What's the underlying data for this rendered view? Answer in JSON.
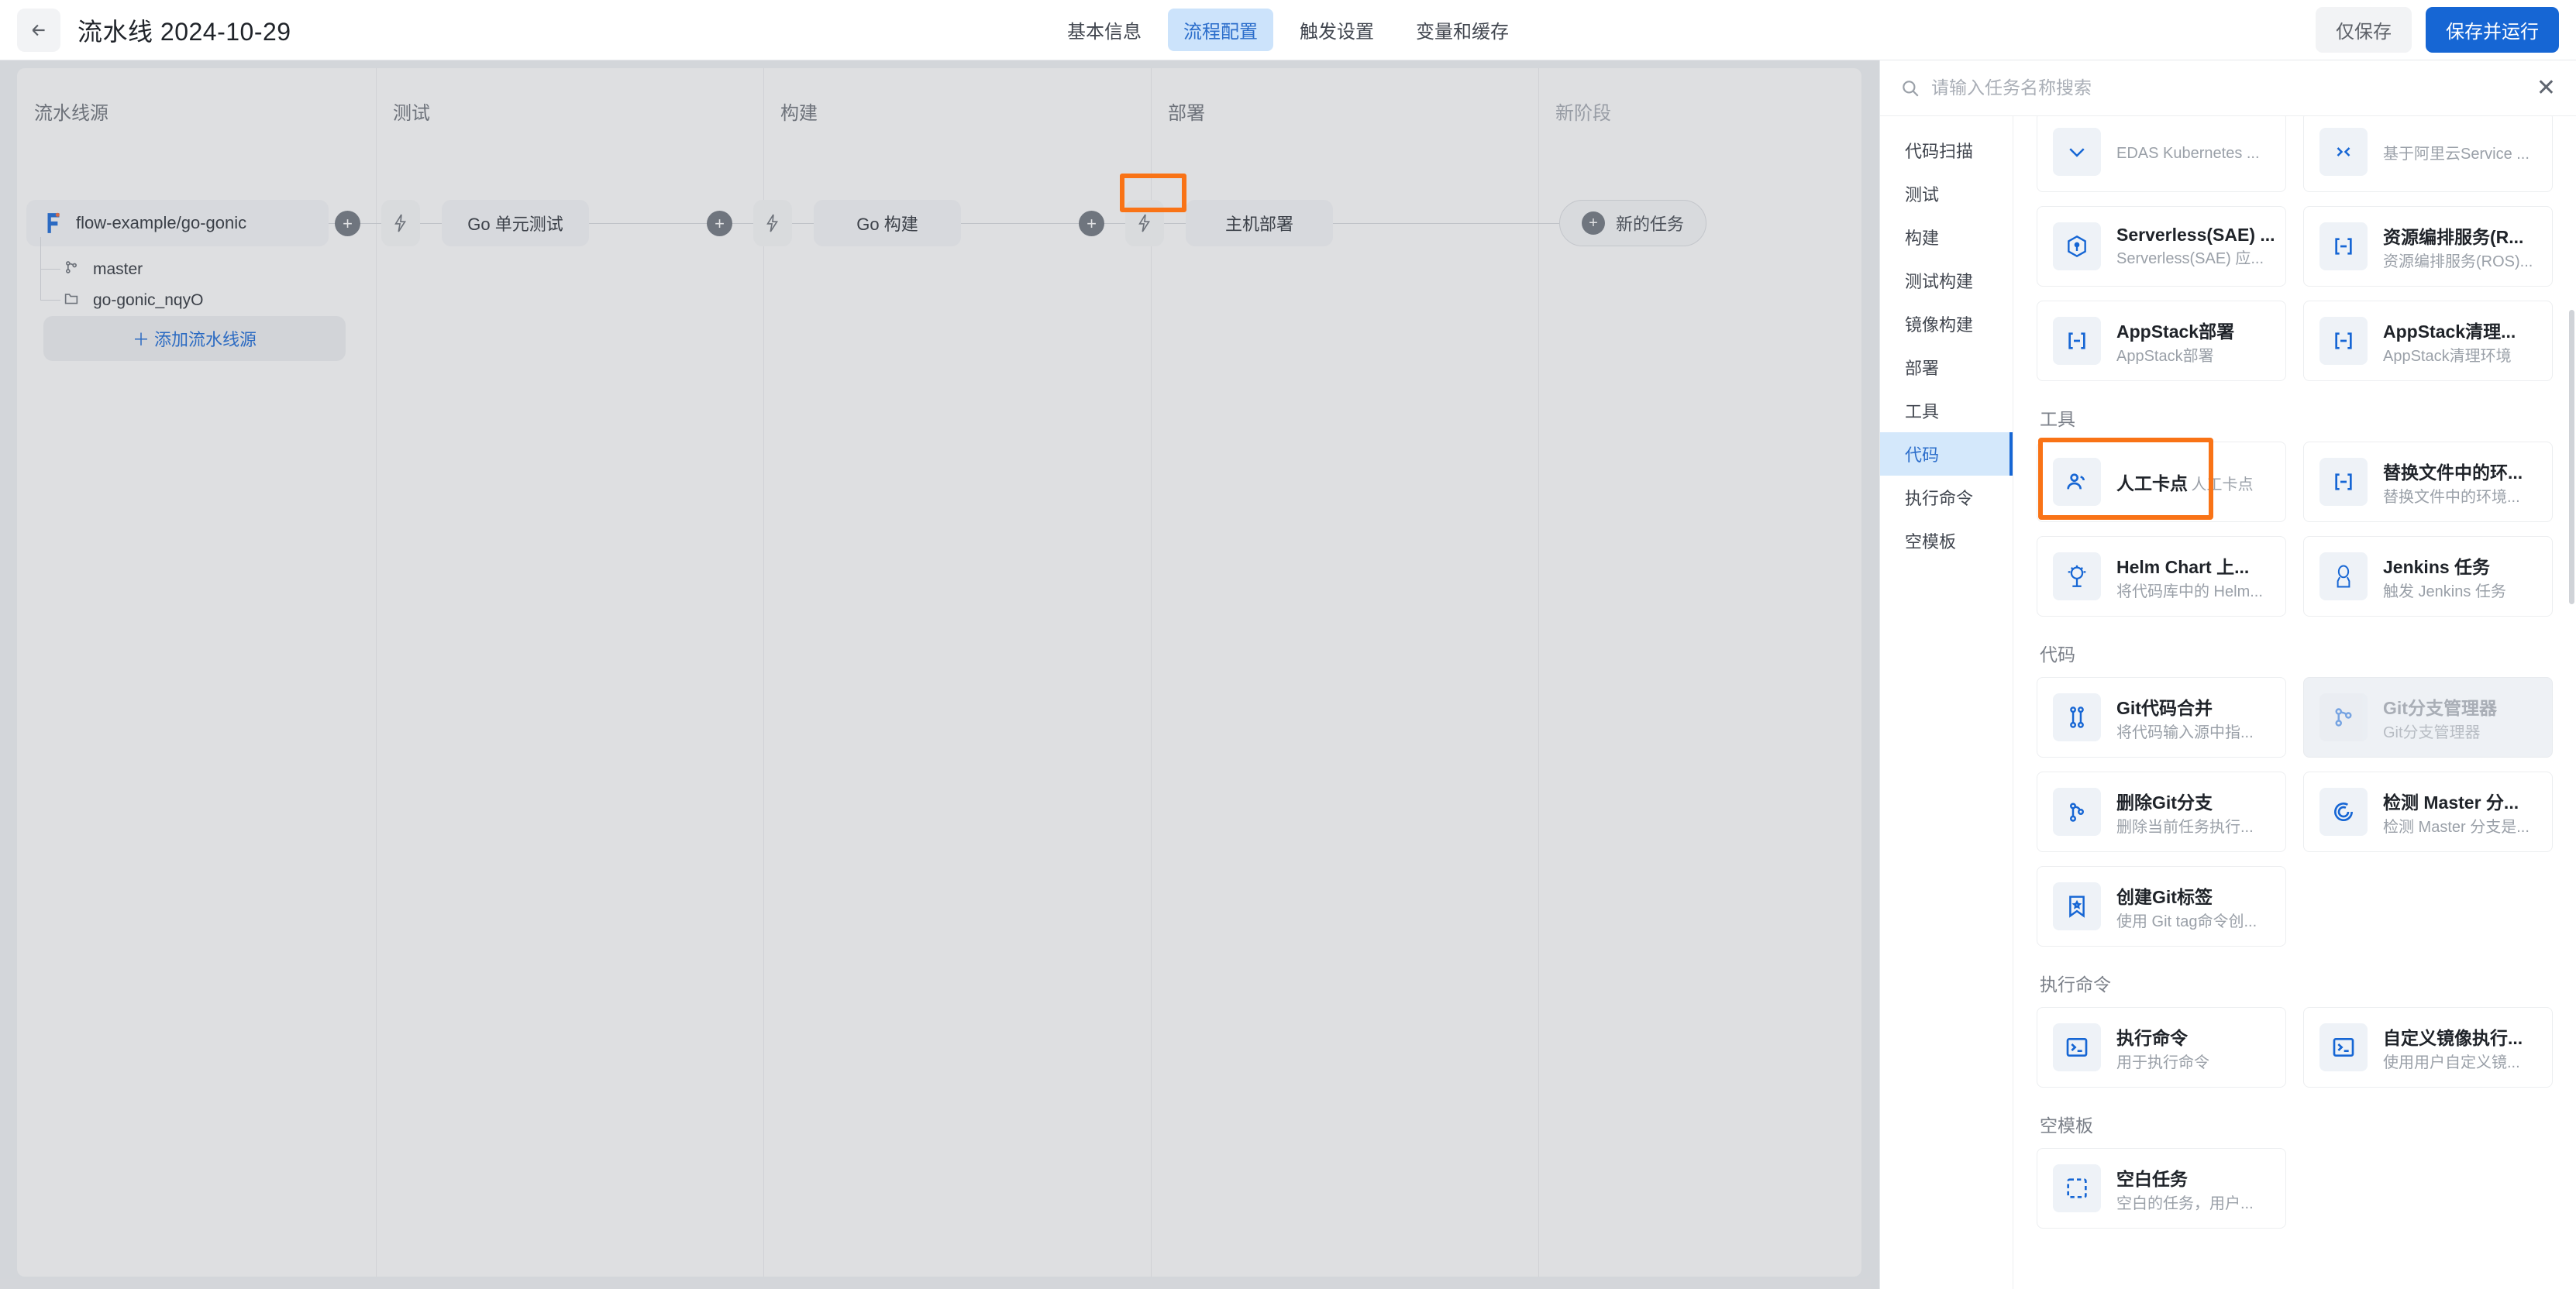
{
  "header": {
    "back_icon": "arrow-left-icon",
    "title": "流水线 2024-10-29",
    "tabs": [
      {
        "label": "基本信息",
        "active": false
      },
      {
        "label": "流程配置",
        "active": true
      },
      {
        "label": "触发设置",
        "active": false
      },
      {
        "label": "变量和缓存",
        "active": false
      }
    ],
    "save_only": "仅保存",
    "save_and_run": "保存并运行",
    "accent": "#1666d4"
  },
  "canvas": {
    "stages": [
      {
        "label": "流水线源",
        "muted": false
      },
      {
        "label": "测试",
        "muted": false
      },
      {
        "label": "构建",
        "muted": false
      },
      {
        "label": "部署",
        "muted": false
      },
      {
        "label": "新阶段",
        "muted": true
      }
    ],
    "source_node": {
      "label": "flow-example/go-gonic",
      "icon": "flow-logo-icon"
    },
    "source_tree": [
      {
        "label": "master",
        "icon": "git-branch-icon"
      },
      {
        "label": "go-gonic_nqyO",
        "icon": "folder-icon"
      }
    ],
    "add_source": "添加流水线源",
    "add_source_plus": "＋",
    "tasks": [
      {
        "label": "Go 单元测试"
      },
      {
        "label": "Go 构建"
      },
      {
        "label": "主机部署"
      }
    ],
    "new_task": "新的任务",
    "plus_glyph": "+",
    "bolt_glyph": "⚡",
    "highlight_color": "#f97316"
  },
  "panel": {
    "search": {
      "placeholder": "请输入任务名称搜索",
      "value": "",
      "icon": "search-icon",
      "close_icon": "close-icon",
      "close_glyph": "✕"
    },
    "categories": [
      {
        "label": "代码扫描",
        "active": false
      },
      {
        "label": "测试",
        "active": false
      },
      {
        "label": "构建",
        "active": false
      },
      {
        "label": "测试构建",
        "active": false
      },
      {
        "label": "镜像构建",
        "active": false
      },
      {
        "label": "部署",
        "active": false
      },
      {
        "label": "工具",
        "active": false
      },
      {
        "label": "代码",
        "active": true
      },
      {
        "label": "执行命令",
        "active": false
      },
      {
        "label": "空模板",
        "active": false
      }
    ],
    "groups": [
      {
        "title": "",
        "cards": [
          {
            "title": "",
            "desc": "EDAS Kubernetes ...",
            "icon": "edas-icon",
            "disabled": false,
            "clipped": true
          },
          {
            "title": "",
            "desc": "基于阿里云Service ...",
            "icon": "service-mesh-icon",
            "disabled": false,
            "clipped": true
          },
          {
            "title": "Serverless(SAE) ...",
            "desc": "Serverless(SAE) 应...",
            "icon": "sae-icon",
            "disabled": false
          },
          {
            "title": "资源编排服务(R...",
            "desc": "资源编排服务(ROS)...",
            "icon": "ros-icon",
            "disabled": false
          },
          {
            "title": "AppStack部署",
            "desc": "AppStack部署",
            "icon": "appstack-icon",
            "disabled": false
          },
          {
            "title": "AppStack清理...",
            "desc": "AppStack清理环境",
            "icon": "appstack-icon",
            "disabled": false
          }
        ]
      },
      {
        "title": "工具",
        "cards": [
          {
            "title": "人工卡点",
            "desc": "人工卡点",
            "icon": "users-icon",
            "disabled": false,
            "highlighted": true
          },
          {
            "title": "替换文件中的环...",
            "desc": "替换文件中的环境...",
            "icon": "appstack-icon",
            "disabled": false
          },
          {
            "title": "Helm Chart 上...",
            "desc": "将代码库中的 Helm...",
            "icon": "helm-icon",
            "disabled": false
          },
          {
            "title": "Jenkins 任务",
            "desc": "触发 Jenkins 任务",
            "icon": "jenkins-icon",
            "disabled": false
          }
        ]
      },
      {
        "title": "代码",
        "cards": [
          {
            "title": "Git代码合并",
            "desc": "将代码输入源中指...",
            "icon": "git-merge-icon",
            "disabled": false
          },
          {
            "title": "Git分支管理器",
            "desc": "Git分支管理器",
            "icon": "git-branch-icon",
            "disabled": true
          },
          {
            "title": "删除Git分支",
            "desc": "删除当前任务执行...",
            "icon": "git-branch-icon",
            "disabled": false
          },
          {
            "title": "检测 Master 分...",
            "desc": "检测 Master 分支是...",
            "icon": "target-icon",
            "disabled": false
          },
          {
            "title": "创建Git标签",
            "desc": "使用 Git tag命令创...",
            "icon": "tag-icon",
            "disabled": false
          }
        ]
      },
      {
        "title": "执行命令",
        "cards": [
          {
            "title": "执行命令",
            "desc": "用于执行命令",
            "icon": "terminal-icon",
            "disabled": false
          },
          {
            "title": "自定义镜像执行...",
            "desc": "使用用户自定义镜...",
            "icon": "terminal-icon",
            "disabled": false
          }
        ]
      },
      {
        "title": "空模板",
        "cards": [
          {
            "title": "空白任务",
            "desc": "空白的任务，用户...",
            "icon": "blank-task-icon",
            "disabled": false
          }
        ]
      }
    ]
  }
}
